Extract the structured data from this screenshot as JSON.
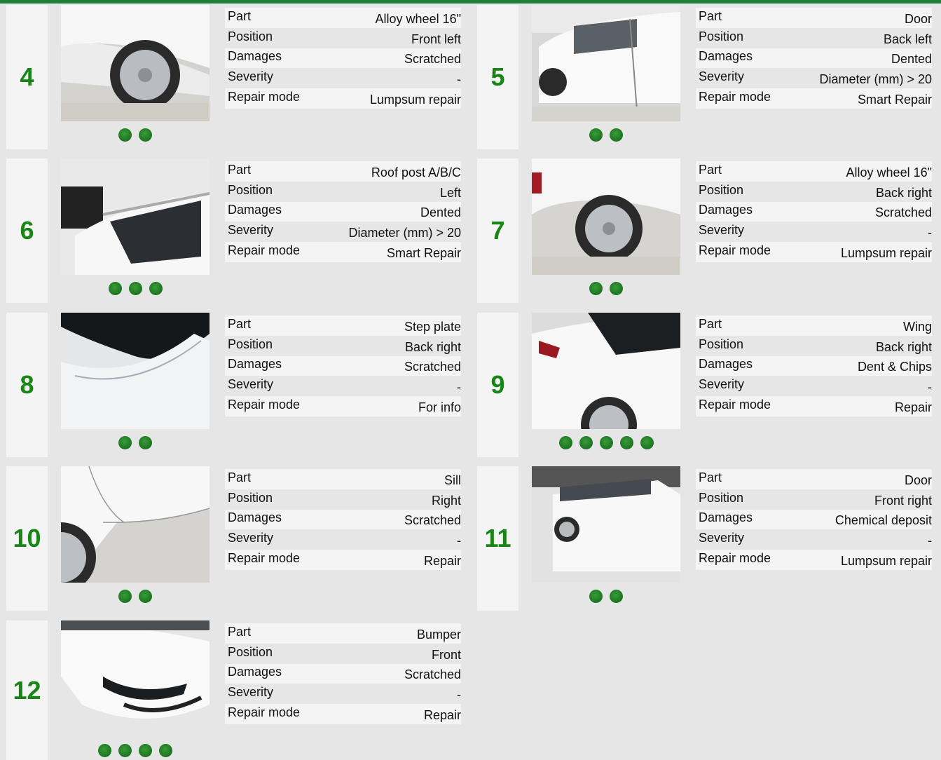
{
  "labels": {
    "part": "Part",
    "position": "Position",
    "damages": "Damages",
    "severity": "Severity",
    "repair_mode": "Repair mode"
  },
  "colors": {
    "accent": "#188516",
    "topbar": "#1e7e3a",
    "dot": "#1f7a23"
  },
  "damages": [
    {
      "num": "4",
      "part": "Alloy wheel 16\"",
      "position": "Front left",
      "damages": "Scratched",
      "severity": "-",
      "repair_mode": "Lumpsum repair",
      "photo_count": 2
    },
    {
      "num": "5",
      "part": "Door",
      "position": "Back left",
      "damages": "Dented",
      "severity": "Diameter (mm) > 20",
      "repair_mode": "Smart Repair",
      "photo_count": 2
    },
    {
      "num": "6",
      "part": "Roof post A/B/C",
      "position": "Left",
      "damages": "Dented",
      "severity": "Diameter (mm) > 20",
      "repair_mode": "Smart Repair",
      "photo_count": 3
    },
    {
      "num": "7",
      "part": "Alloy wheel 16\"",
      "position": "Back right",
      "damages": "Scratched",
      "severity": "-",
      "repair_mode": "Lumpsum repair",
      "photo_count": 2
    },
    {
      "num": "8",
      "part": "Step plate",
      "position": "Back right",
      "damages": "Scratched",
      "severity": "-",
      "repair_mode": "For info",
      "photo_count": 2
    },
    {
      "num": "9",
      "part": "Wing",
      "position": "Back right",
      "damages": "Dent & Chips",
      "severity": "-",
      "repair_mode": "Repair",
      "photo_count": 5
    },
    {
      "num": "10",
      "part": "Sill",
      "position": "Right",
      "damages": "Scratched",
      "severity": "-",
      "repair_mode": "Repair",
      "photo_count": 2
    },
    {
      "num": "11",
      "part": "Door",
      "position": "Front right",
      "damages": "Chemical deposit",
      "severity": "-",
      "repair_mode": "Lumpsum repair",
      "photo_count": 2
    },
    {
      "num": "12",
      "part": "Bumper",
      "position": "Front",
      "damages": "Scratched",
      "severity": "-",
      "repair_mode": "Repair",
      "photo_count": 4
    }
  ]
}
